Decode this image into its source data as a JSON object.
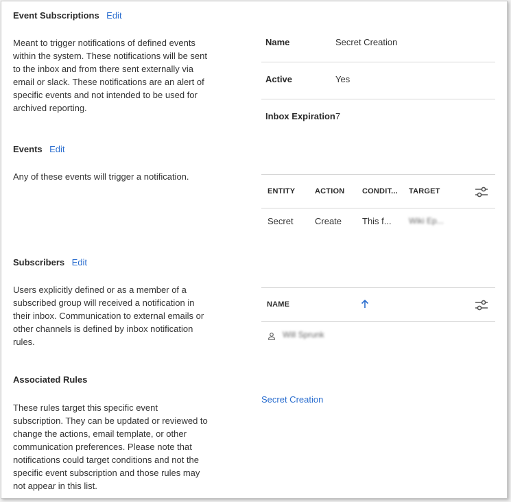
{
  "event_subscriptions": {
    "heading": "Event Subscriptions",
    "edit_label": "Edit",
    "description": "Meant to trigger notifications of defined events within the system. These notifications will be sent to the inbox and from there sent externally via email or slack. These notifications are an alert of specific events and not intended to be used for archived reporting.",
    "fields": {
      "name_label": "Name",
      "name_value": "Secret Creation",
      "active_label": "Active",
      "active_value": "Yes",
      "inbox_label": "Inbox Expiration",
      "inbox_value": "7"
    }
  },
  "events": {
    "heading": "Events",
    "edit_label": "Edit",
    "description": "Any of these events will trigger a notification.",
    "columns": [
      "ENTITY",
      "ACTION",
      "CONDIT...",
      "TARGET"
    ],
    "rows": [
      {
        "entity": "Secret",
        "action": "Create",
        "condition": "This f...",
        "target": "Wiki Ep..."
      }
    ],
    "settings_icon": "column-settings-icon"
  },
  "subscribers": {
    "heading": "Subscribers",
    "edit_label": "Edit",
    "description": "Users explicitly defined or as a member of a subscribed group will received a notification in their inbox. Communication to external emails or other channels is defined by inbox notification rules.",
    "column_name": "NAME",
    "sort_icon": "sort-ascending-icon",
    "rows": [
      {
        "name": "Will Sprunk",
        "icon": "user-icon"
      }
    ]
  },
  "associated_rules": {
    "heading": "Associated Rules",
    "description": "These rules target this specific event subscription. They can be updated or reviewed to change the actions, email template, or other communication preferences. Please note that notifications could target conditions and not the specific event subscription and those rules may not appear in this list.",
    "links": [
      "Secret Creation"
    ]
  },
  "colors": {
    "link": "#2b6ecf",
    "divider": "#d6d6d6",
    "text": "#333333"
  }
}
